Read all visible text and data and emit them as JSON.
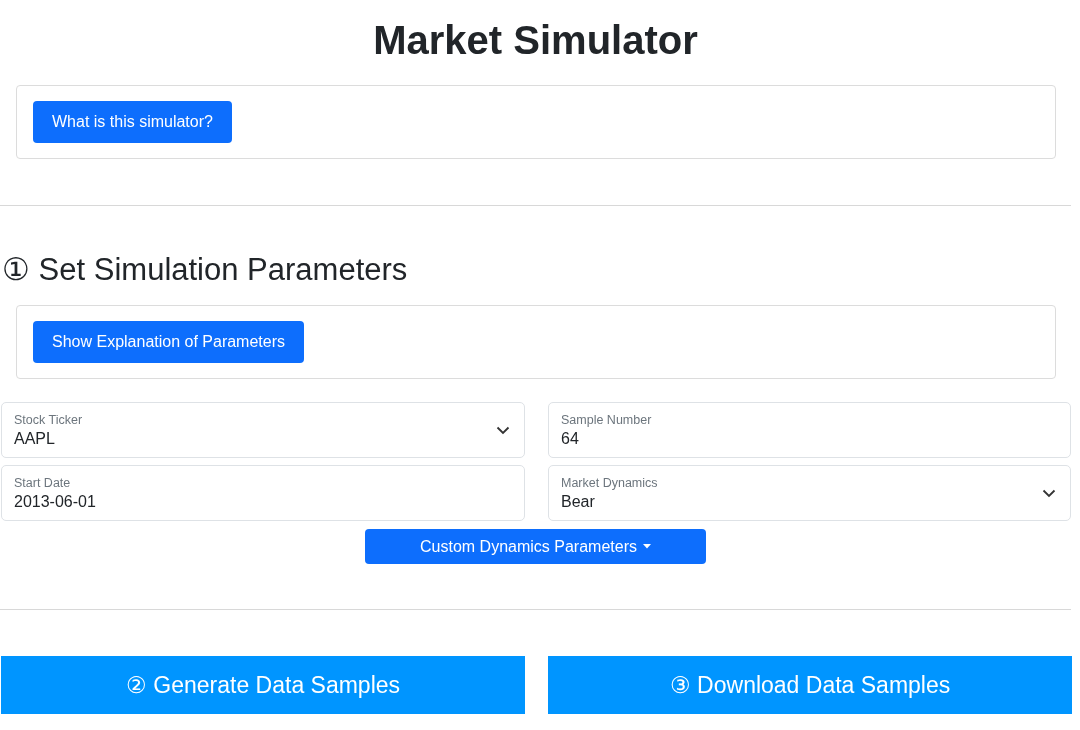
{
  "title": "Market Simulator",
  "intro": {
    "button": "What is this simulator?"
  },
  "section": {
    "heading": "① Set Simulation Parameters",
    "button": "Show Explanation of Parameters"
  },
  "fields": [
    {
      "kind": "select",
      "label": "Stock Ticker",
      "value": "AAPL"
    },
    {
      "kind": "input",
      "label": "Sample Number",
      "value": "64"
    },
    {
      "kind": "input",
      "label": "Start Date",
      "value": "2013-06-01"
    },
    {
      "kind": "select",
      "label": "Market Dynamics",
      "value": "Bear"
    }
  ],
  "custom_button": "Custom Dynamics Parameters",
  "actions": [
    {
      "label": "② Generate Data Samples"
    },
    {
      "label": "③ Download Data Samples"
    }
  ]
}
